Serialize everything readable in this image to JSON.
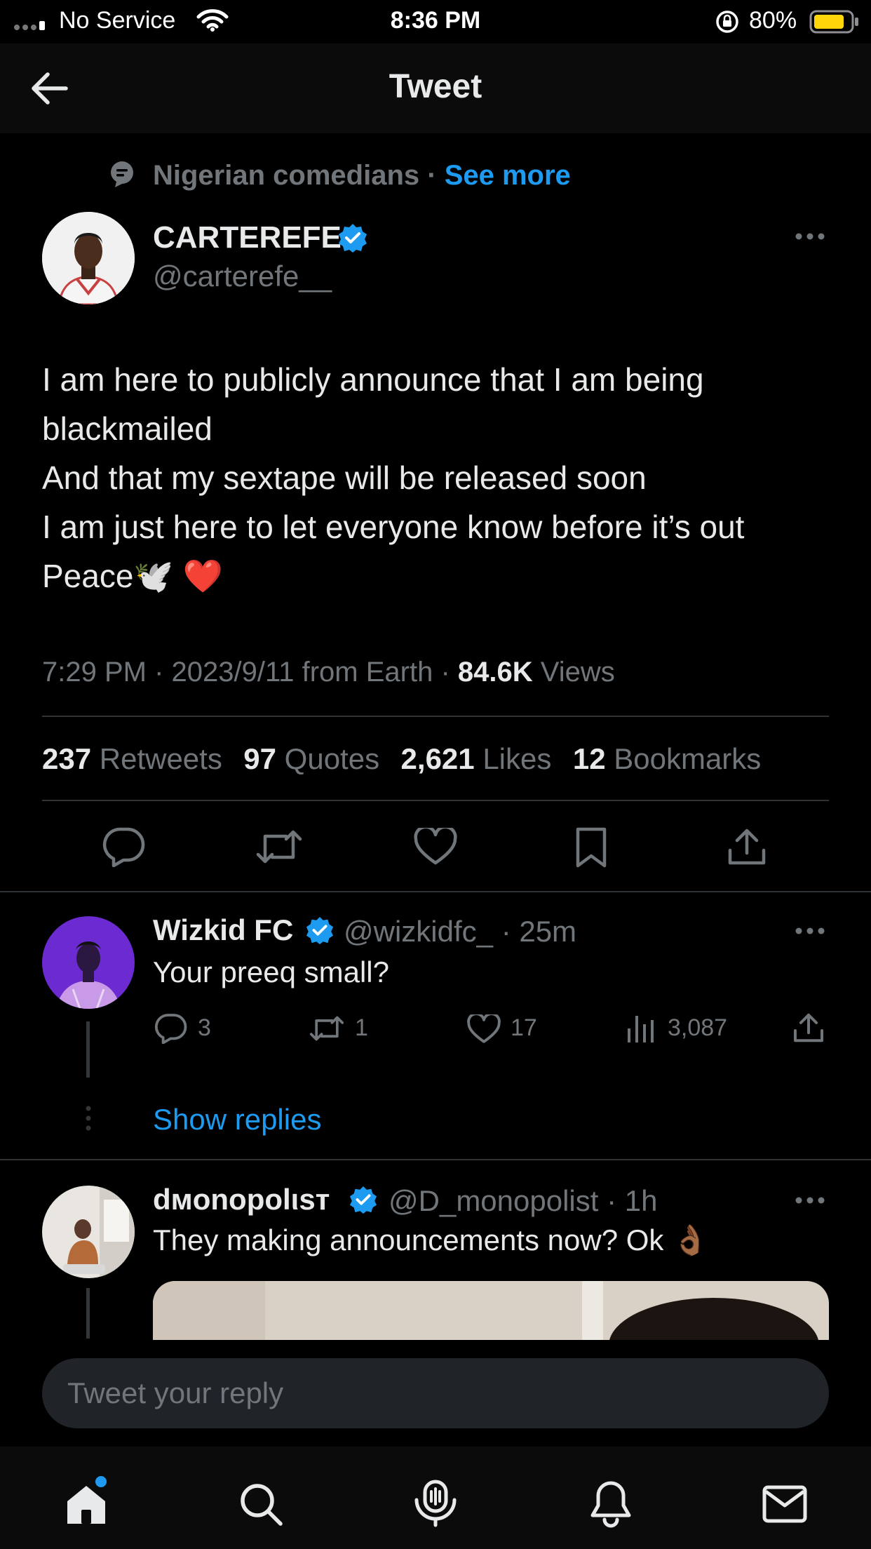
{
  "status_bar": {
    "carrier": "No Service",
    "time": "8:36 PM",
    "battery": "80%"
  },
  "header": {
    "title": "Tweet"
  },
  "context": {
    "topic": "Nigerian comedians",
    "separator": "·",
    "see_more": "See more"
  },
  "main_tweet": {
    "display_name": "CARTEREFE",
    "handle": "@carterefe__",
    "text": "I am here to publicly announce that I am being blackmailed\nAnd that my sextape will be released soon\nI am just here to let everyone know before it’s out\nPeace🕊️ ❤️",
    "timestamp": "7:29 PM · 2023/9/11 from Earth · ",
    "views_count": "84.6K",
    "views_label": " Views",
    "retweets_count": "237",
    "retweets_label": "Retweets",
    "quotes_count": "97",
    "quotes_label": "Quotes",
    "likes_count": "2,621",
    "likes_label": "Likes",
    "bookmarks_count": "12",
    "bookmarks_label": "Bookmarks"
  },
  "replies": [
    {
      "display_name": "Wizkid FC",
      "handle": "@wizkidfc_",
      "time": "· 25m",
      "text": "Your preeq small?",
      "reply_count": "3",
      "retweet_count": "1",
      "like_count": "17",
      "view_count": "3,087",
      "show_replies": "Show replies"
    },
    {
      "display_name": "dмonopolιsт",
      "handle": "@D_monopolist",
      "time": "· 1h",
      "text": "They making announcements now? Ok 👌🏾"
    }
  ],
  "composer": {
    "placeholder": "Tweet your reply"
  },
  "colors": {
    "accent": "#1d9bf0",
    "background": "#000000",
    "muted": "#71767b",
    "battery": "#ffd60a"
  },
  "icons": {
    "back": "arrow-left-icon",
    "verified": "verified-badge-icon",
    "more": "more-horizontal-icon",
    "reply": "reply-icon",
    "retweet": "retweet-icon",
    "like": "heart-icon",
    "bookmark": "bookmark-icon",
    "share": "share-icon",
    "views": "analytics-icon",
    "home": "home-icon",
    "search": "search-icon",
    "spaces": "spaces-icon",
    "notifications": "bell-icon",
    "messages": "mail-icon"
  }
}
